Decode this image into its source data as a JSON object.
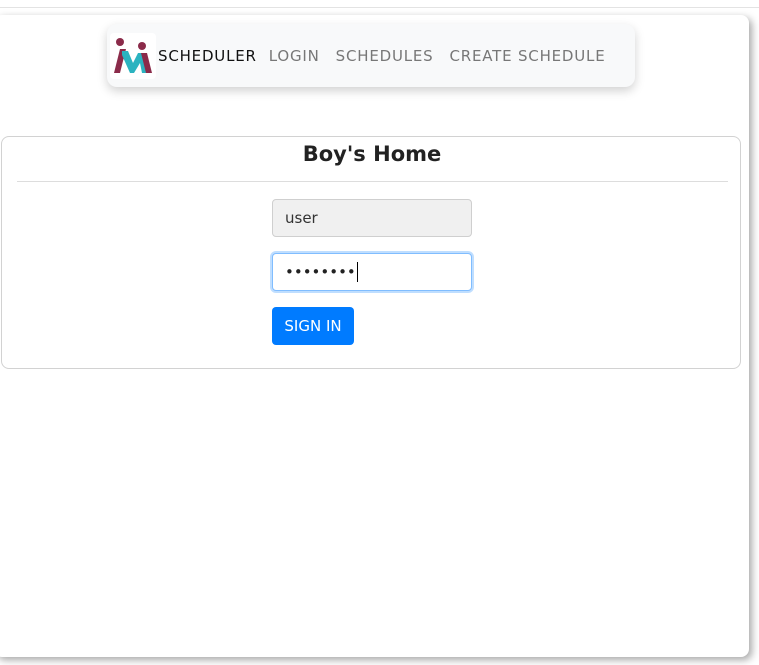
{
  "navbar": {
    "brand": "SCHEDULER",
    "links": [
      "LOGIN",
      "SCHEDULES",
      "CREATE SCHEDULE"
    ],
    "logo_icon": "scheduler-logo-icon",
    "logo_colors": [
      "#8b2b4a",
      "#2bb3c0"
    ]
  },
  "card": {
    "title": "Boy's Home",
    "username": {
      "value": "user"
    },
    "password": {
      "masked_value": "••••••••"
    },
    "signin_label": "SIGN IN"
  },
  "colors": {
    "primary": "#007bff",
    "navbar_bg": "#f8f9fa"
  }
}
